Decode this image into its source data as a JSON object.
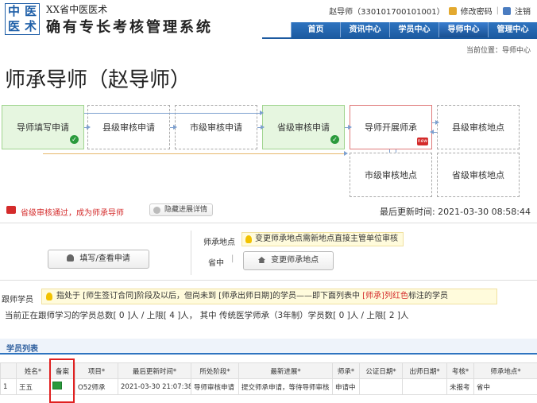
{
  "header": {
    "logo_chars": [
      "中",
      "医",
      "医",
      "术"
    ],
    "subtitle": "XX省中医医术",
    "title": "确有专长考核管理系统",
    "user": "赵导师（330101700101001）",
    "change_password": "修改密码",
    "logout": "注销",
    "nav": [
      "首页",
      "资讯中心",
      "学员中心",
      "导师中心",
      "管理中心"
    ],
    "active_nav": "导师中心"
  },
  "breadcrumb": "当前位置：导师中心",
  "page_title": "师承导师（赵导师）",
  "flow": {
    "nodes": [
      {
        "label": "导师填写申请",
        "state": "done"
      },
      {
        "label": "县级审核申请",
        "state": "pending"
      },
      {
        "label": "市级审核申请",
        "state": "pending"
      },
      {
        "label": "省级审核申请",
        "state": "done"
      },
      {
        "label": "导师开展师承",
        "state": "current"
      },
      {
        "label": "县级审核地点",
        "state": "pending"
      },
      {
        "label": "市级审核地点",
        "state": "pending"
      },
      {
        "label": "省级审核地点",
        "state": "pending"
      }
    ],
    "ok_badge": "✓",
    "new_badge": "new"
  },
  "status": {
    "message": "省级审核通过，成为师承导师",
    "hide_button": "隐藏进展详情",
    "updated_label": "最后更新时间:",
    "updated_value": "2021-03-30 08:58:44"
  },
  "actions": {
    "fill_button": "填写/查看申请",
    "location_label": "师承地点",
    "location_tip": "变更师承地点需新地点直接主管单位审核",
    "province": "省中",
    "province_sep": "|",
    "change_location_button": "变更师承地点"
  },
  "follow": {
    "label": "跟师学员",
    "tip_1": "指处于 [师生签订合同]阶段及以后，但尚未到 [师承出师日期]的学员——即下面列表中 ",
    "tip_red_1": "[师承]列红色",
    "tip_2": "标注的学员",
    "count_line": "当前正在跟师学习的学员总数[ 0 ]人 / 上限[ 4 ]人，  其中 传统医学师承（3年制）学员数[ 0 ]人 / 上限[ 2 ]人"
  },
  "student_list": {
    "title": "学员列表",
    "columns": [
      "",
      "姓名*",
      "备案",
      "项目*",
      "最后更新时间*",
      "所处阶段*",
      "最新进展*",
      "师承*",
      "公证日期*",
      "出师日期*",
      "考核*",
      "师承地点*"
    ],
    "rows": [
      [
        "1",
        "王五",
        "",
        "O52师承",
        "2021-03-30 21:07:38",
        "导师审核申请",
        "提交师承申请，等待导师审核",
        "申请中",
        "",
        "",
        "未报考",
        "省中"
      ]
    ]
  },
  "colors": {
    "primary": "#1c5aa0",
    "done_fill": "#e6f6e0",
    "alert_red": "#d42b2b",
    "tip_bg": "#fffbdc"
  }
}
